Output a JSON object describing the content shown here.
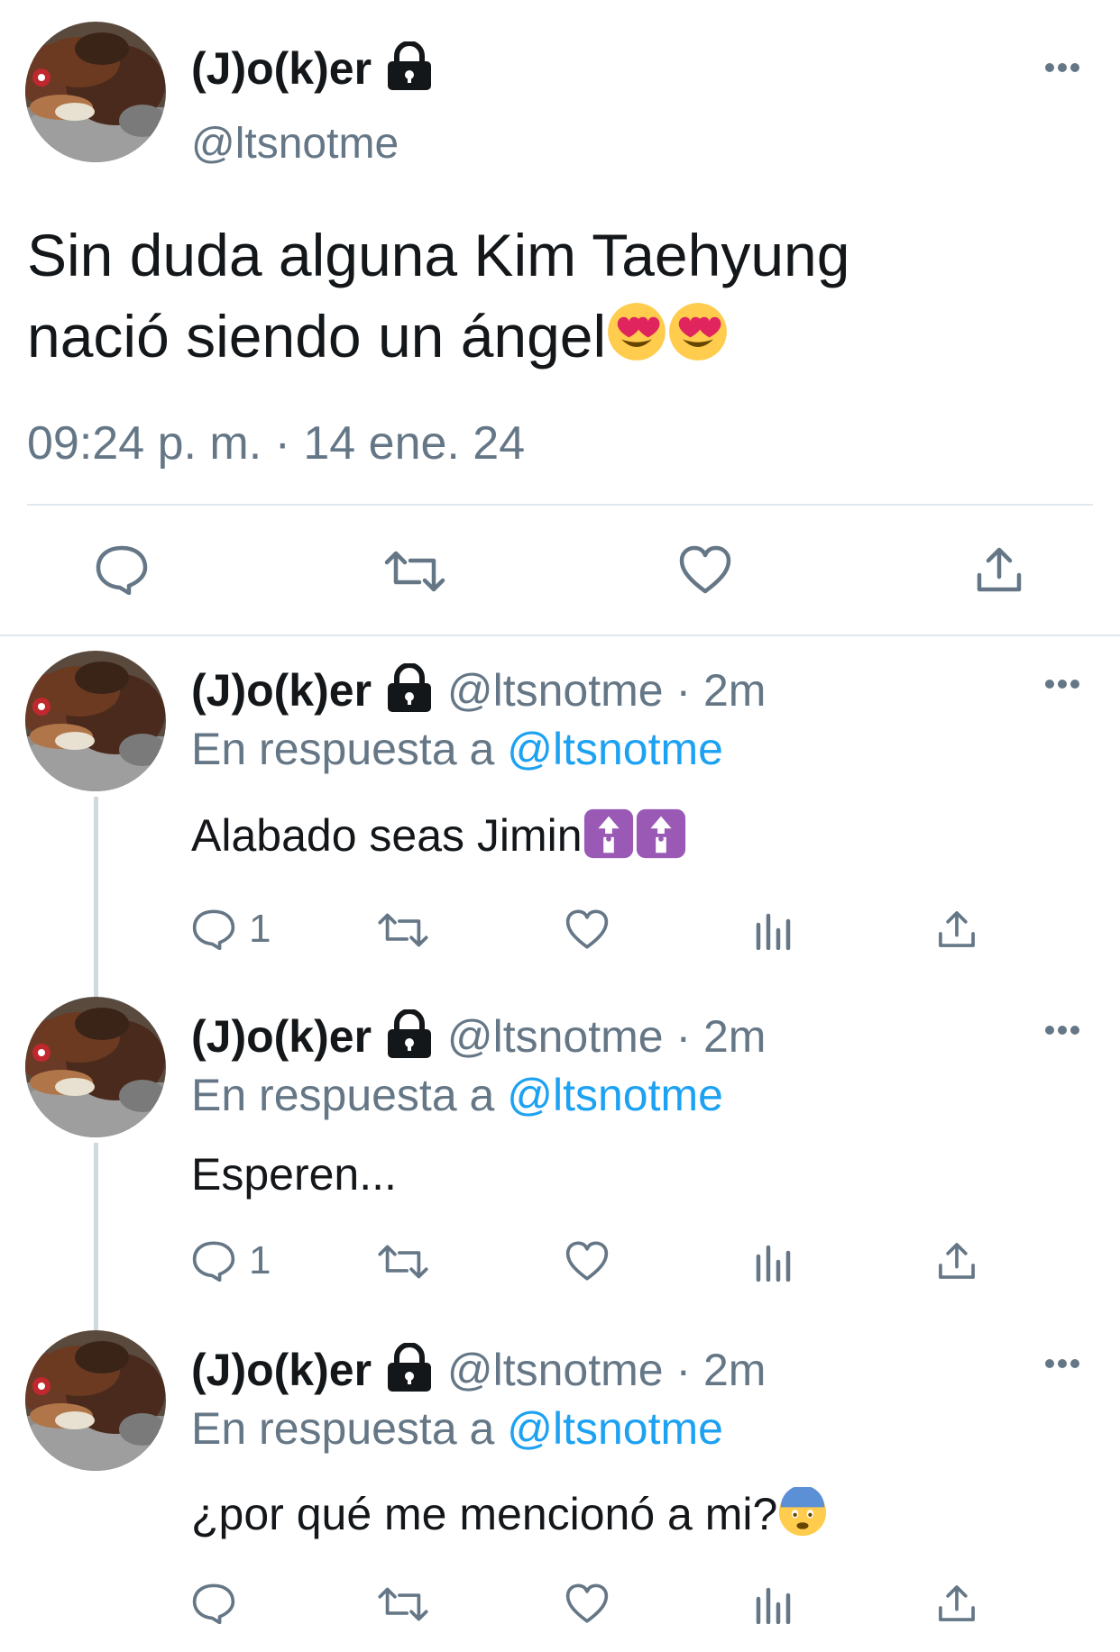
{
  "main_tweet": {
    "display_name": "(J)o(k)er",
    "handle": "@ltsnotme",
    "text_line1": "Sin duda alguna Kim Taehyung",
    "text_line2": "nació siendo un ángel",
    "timestamp": "09:24 p. m. · 14 ene. 24"
  },
  "replies": [
    {
      "display_name": "(J)o(k)er",
      "meta": "@ltsnotme · 2m",
      "reply_prefix": "En respuesta a",
      "reply_mention": "@ltsnotme",
      "text": "Alabado seas Jimin",
      "reply_count": "1"
    },
    {
      "display_name": "(J)o(k)er",
      "meta": "@ltsnotme · 2m",
      "reply_prefix": "En respuesta a",
      "reply_mention": "@ltsnotme",
      "text": "Esperen...",
      "reply_count": "1"
    },
    {
      "display_name": "(J)o(k)er",
      "meta": "@ltsnotme · 2m",
      "reply_prefix": "En respuesta a",
      "reply_mention": "@ltsnotme",
      "text": "¿por qué me mencionó a mi?",
      "reply_count": ""
    }
  ],
  "icons": {
    "reply": "speech-bubble-icon",
    "retweet": "retweet-icon",
    "like": "heart-icon",
    "share": "share-upload-icon",
    "analytics": "analytics-bars-icon",
    "more": "more-dots-icon",
    "lock": "lock-icon"
  },
  "colors": {
    "text": "#14171a",
    "secondary": "#657786",
    "link": "#1da1f2",
    "divider": "#e1e8ed"
  }
}
